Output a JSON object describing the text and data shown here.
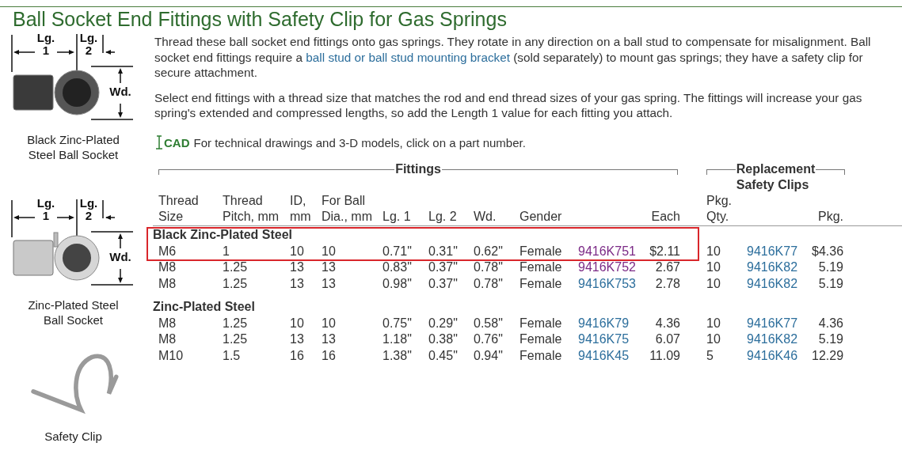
{
  "title": "Ball Socket End Fittings with Safety Clip for Gas Springs",
  "figures": [
    {
      "kind": "black_socket",
      "dimension_labels": [
        "Lg.",
        "1",
        "Lg.",
        "2",
        "Wd."
      ],
      "caption": "Black Zinc-Plated Steel Ball Socket"
    },
    {
      "kind": "zinc_socket",
      "dimension_labels": [
        "Lg.",
        "1",
        "Lg.",
        "2",
        "Wd."
      ],
      "caption": "Zinc-Plated Steel Ball Socket"
    },
    {
      "kind": "clip",
      "caption": "Safety Clip"
    }
  ],
  "paragraphs": [
    [
      {
        "text": "Thread these ball socket end fittings onto gas springs. They rotate in any direction on a ball stud to compensate for misalignment. Ball socket end fittings require a "
      },
      {
        "link": "ball stud or ball stud mounting bracket"
      },
      {
        "text": " (sold separately) to mount gas springs; they have a safety clip for secure attachment."
      }
    ],
    [
      {
        "text": "Select end fittings with a thread size that matches the rod and end thread sizes of your gas spring. The fittings will increase your gas spring's extended and compressed lengths, so add the Length 1 value for each fitting you attach."
      }
    ]
  ],
  "cad_note": {
    "badge": "CAD",
    "text": "For technical drawings and 3-D models, click on a part number."
  },
  "table": {
    "group_headers": [
      "Fittings",
      "Replacement Safety Clips"
    ],
    "columns": [
      [
        "Thread",
        "Size"
      ],
      [
        "Thread",
        "Pitch, mm"
      ],
      [
        "ID,",
        "mm"
      ],
      [
        "For Ball",
        "Dia., mm"
      ],
      [
        "Lg. 1"
      ],
      [
        "Lg. 2"
      ],
      [
        "Wd."
      ],
      [
        "Gender"
      ],
      [],
      [
        "Each"
      ],
      [
        "Pkg.",
        "Qty."
      ],
      [],
      [
        "Pkg."
      ]
    ],
    "groups": [
      {
        "title": "Black Zinc-Plated Steel",
        "rows": [
          {
            "cells": [
              "M6",
              "1",
              "10",
              "10",
              "0.71\"",
              "0.31\"",
              "0.62\"",
              "Female"
            ],
            "part": {
              "number": "9416K751",
              "visited": true
            },
            "price": "$2.11",
            "clip_qty": "10",
            "clip_part": {
              "number": "9416K77",
              "visited": false
            },
            "clip_price": "$4.36",
            "highlighted": true
          },
          {
            "cells": [
              "M8",
              "1.25",
              "13",
              "13",
              "0.83\"",
              "0.37\"",
              "0.78\"",
              "Female"
            ],
            "part": {
              "number": "9416K752",
              "visited": true
            },
            "price": "2.67",
            "clip_qty": "10",
            "clip_part": {
              "number": "9416K82",
              "visited": false
            },
            "clip_price": "5.19",
            "highlighted": false
          },
          {
            "cells": [
              "M8",
              "1.25",
              "13",
              "13",
              "0.98\"",
              "0.37\"",
              "0.78\"",
              "Female"
            ],
            "part": {
              "number": "9416K753",
              "visited": false
            },
            "price": "2.78",
            "clip_qty": "10",
            "clip_part": {
              "number": "9416K82",
              "visited": false
            },
            "clip_price": "5.19",
            "highlighted": false
          }
        ]
      },
      {
        "title": "Zinc-Plated Steel",
        "rows": [
          {
            "cells": [
              "M8",
              "1.25",
              "10",
              "10",
              "0.75\"",
              "0.29\"",
              "0.58\"",
              "Female"
            ],
            "part": {
              "number": "9416K79",
              "visited": false
            },
            "price": "4.36",
            "clip_qty": "10",
            "clip_part": {
              "number": "9416K77",
              "visited": false
            },
            "clip_price": "4.36",
            "highlighted": false
          },
          {
            "cells": [
              "M8",
              "1.25",
              "13",
              "13",
              "1.18\"",
              "0.38\"",
              "0.76\"",
              "Female"
            ],
            "part": {
              "number": "9416K75",
              "visited": false
            },
            "price": "6.07",
            "clip_qty": "10",
            "clip_part": {
              "number": "9416K82",
              "visited": false
            },
            "clip_price": "5.19",
            "highlighted": false
          },
          {
            "cells": [
              "M10",
              "1.5",
              "16",
              "16",
              "1.38\"",
              "0.45\"",
              "0.94\"",
              "Female"
            ],
            "part": {
              "number": "9416K45",
              "visited": false
            },
            "price": "11.09",
            "clip_qty": "5",
            "clip_part": {
              "number": "9416K46",
              "visited": false
            },
            "clip_price": "12.29",
            "highlighted": false
          }
        ]
      }
    ]
  }
}
